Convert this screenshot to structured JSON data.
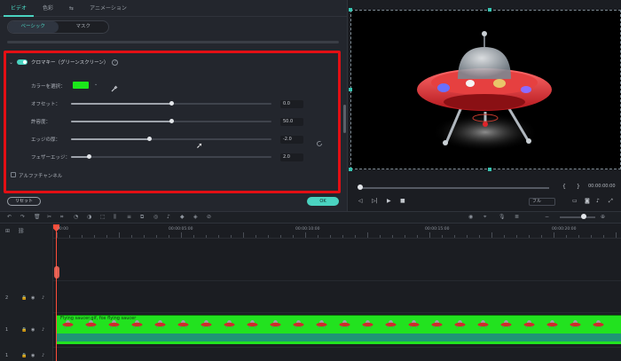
{
  "tabs": [
    "ビデオ",
    "色彩",
    "",
    "アニメーション"
  ],
  "subtabs": [
    "ベーシック",
    "マスク"
  ],
  "chroma": {
    "title": "クロマキー（グリーンスクリーン）",
    "color_label": "カラーを選択：",
    "color_hex": "#1be81a",
    "sliders": [
      {
        "label": "オフセット：",
        "value": "0.0",
        "fraction": 0.5
      },
      {
        "label": "許容度：",
        "value": "50.0",
        "fraction": 0.5
      },
      {
        "label": "エッジの厚：",
        "value": "-2.0",
        "fraction": 0.39
      },
      {
        "label": "フェザーエッジ：",
        "value": "2.0",
        "fraction": 0.09
      }
    ],
    "alpha_label": "アルファチャンネル"
  },
  "buttons": {
    "reset": "リセット",
    "ok": "OK"
  },
  "preview": {
    "timecode": "00:00:00:00",
    "quality": "フル",
    "progress_fraction": 0.0
  },
  "timeline": {
    "ruler_labels": [
      "00:00",
      "00:00:05:00",
      "00:00:10:00",
      "00:00:15:00",
      "00:00:20:00"
    ],
    "tracks": [
      "2",
      "1",
      "1"
    ],
    "clip_label": "Flying saucer.gif, fox flying saucer"
  },
  "colors": {
    "accent": "#4ad3c0",
    "frame": "#e30f14",
    "clip": "#22e21f"
  }
}
